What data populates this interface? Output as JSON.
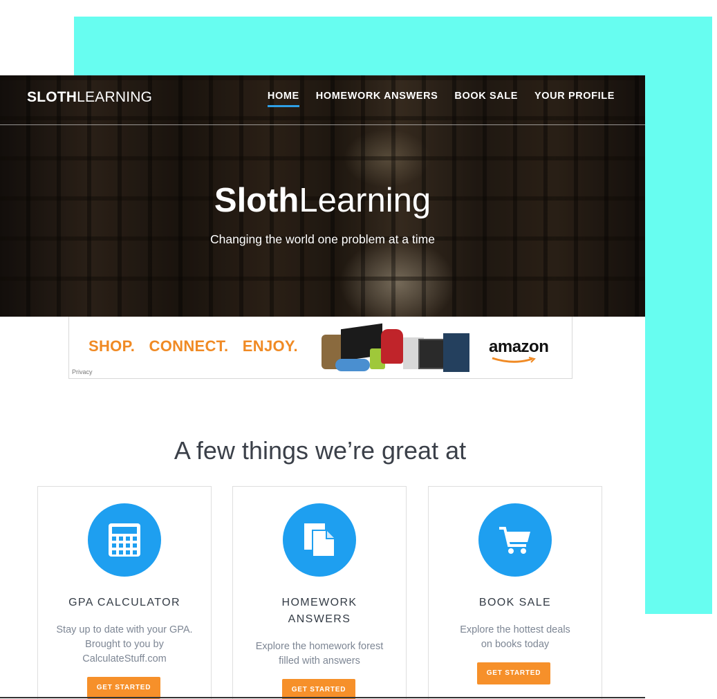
{
  "nav": {
    "logo_bold": "SLOTH",
    "logo_light": "LEARNING",
    "items": [
      {
        "label": "HOME",
        "active": true
      },
      {
        "label": "HOMEWORK ANSWERS",
        "active": false
      },
      {
        "label": "BOOK SALE",
        "active": false
      },
      {
        "label": "YOUR PROFILE",
        "active": false
      }
    ]
  },
  "hero": {
    "title_bold": "Sloth",
    "title_light": "Learning",
    "subtitle": "Changing the world one problem at a time"
  },
  "ad": {
    "slogan": "SHOP. CONNECT. ENJOY.",
    "brand": "amazon",
    "privacy": "Privacy"
  },
  "features": {
    "heading": "A few things we’re great at",
    "cards": [
      {
        "icon": "calculator-icon",
        "title": "GPA CALCULATOR",
        "desc": "Stay up to date with your GPA. Brought to you by CalculateStuff.com",
        "button": "GET STARTED"
      },
      {
        "icon": "document-icon",
        "title": "HOMEWORK ANSWERS",
        "desc": "Explore the homework forest filled with answers",
        "button": "GET STARTED"
      },
      {
        "icon": "cart-icon",
        "title": "BOOK SALE",
        "desc": "Explore the hottest deals on books today",
        "button": "GET STARTED"
      }
    ]
  },
  "colors": {
    "accent_bg": "#67fdf0",
    "icon_blue": "#1e9ff0",
    "button_orange": "#f6902a",
    "nav_underline": "#2fa0e6"
  }
}
